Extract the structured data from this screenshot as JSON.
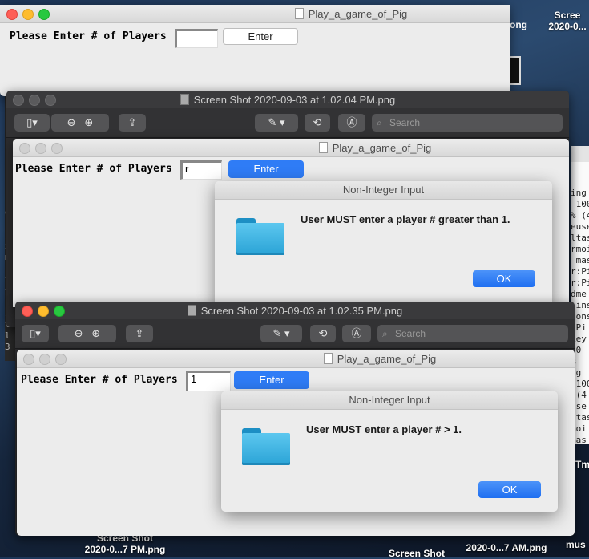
{
  "desktop": {
    "label_top_right": "Scree\n2020-0...",
    "label_bottom_left": "Screen Shot\n2020-0...7 PM.png",
    "label_bottom_mid": "Screen Shot",
    "label_bottom_right": "2020-0...7 AM.png",
    "label_bottom_far_right": "mus",
    "label_tm": "Tm",
    "terminal_fragment_top": "ong"
  },
  "terminal_lines": [
    "ing",
    " 100",
    "% (4",
    "euse",
    "ltas",
    "rmoi",
    " mas",
    "r:Pi",
    "r:Pi",
    "dme",
    " ins",
    "cons",
    ":Pi",
    "key",
    "10",
    "%",
    "ng",
    " 100",
    " (4",
    "use",
    "ltas",
    "moi",
    "mas"
  ],
  "left_terminal_lines": [
    "d",
    "c",
    "y",
    "x",
    "m",
    "f",
    "t",
    "y",
    "n",
    "i",
    "t",
    "l",
    "3"
  ],
  "win1": {
    "title": "Play_a_game_of_Pig",
    "label": "Please Enter # of Players",
    "input_value": "",
    "button": "Enter"
  },
  "preview1": {
    "title": "Screen Shot 2020-09-03 at 1.02.04 PM.png",
    "search_placeholder": "Search"
  },
  "win2": {
    "title": "Play_a_game_of_Pig",
    "label": "Please Enter # of Players",
    "input_value": "r",
    "button": "Enter",
    "dialog_title": "Non-Integer Input",
    "dialog_message": "User MUST enter a player # greater than 1.",
    "dialog_ok": "OK"
  },
  "preview2": {
    "title": "Screen Shot 2020-09-03 at 1.02.35 PM.png",
    "search_placeholder": "Search"
  },
  "win3": {
    "title": "Play_a_game_of_Pig",
    "label": "Please Enter # of Players",
    "input_value": "1",
    "button": "Enter",
    "dialog_title": "Non-Integer Input",
    "dialog_message": "User MUST enter a player # > 1.",
    "dialog_ok": "OK"
  },
  "colors": {
    "accent": "#2f7cf6",
    "folder": "#2aa3d6"
  }
}
